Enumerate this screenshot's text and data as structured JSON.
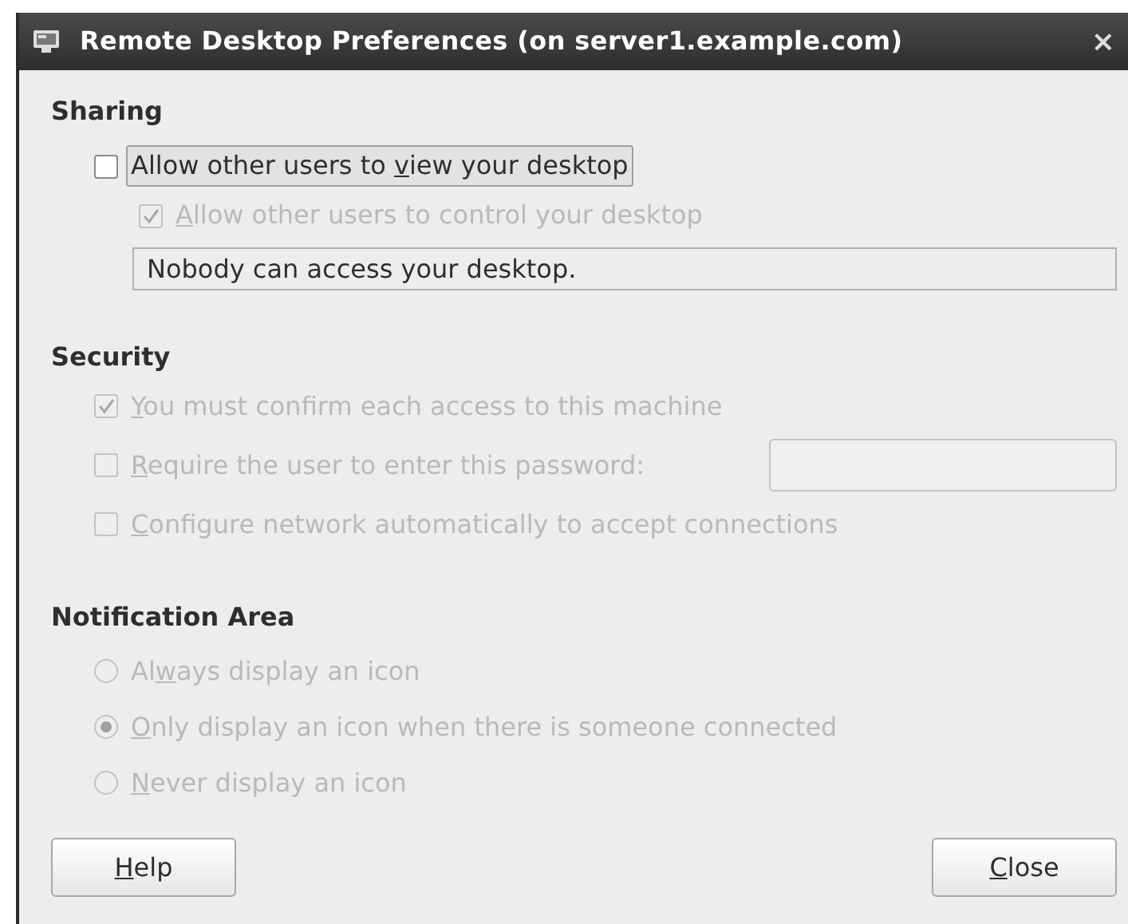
{
  "window": {
    "title": "Remote Desktop Preferences (on server1.example.com)",
    "close": "×"
  },
  "sharing": {
    "heading": "Sharing",
    "options": [
      {
        "kind": "checkbox",
        "before": "Allow other users to ",
        "mnemonic": "v",
        "after": "iew your desktop",
        "checked": false,
        "disabled": false,
        "focused": true,
        "children": [
          {
            "kind": "checkbox",
            "mnemonic": "A",
            "after": "llow other users to control your desktop",
            "checked": true,
            "disabled": true,
            "focused": false
          }
        ]
      }
    ],
    "status": "Nobody can access your desktop."
  },
  "security": {
    "heading": "Security",
    "options": [
      {
        "kind": "checkbox",
        "mnemonic": "Y",
        "after": "ou must confirm each access to this machine",
        "checked": true,
        "disabled": true,
        "focused": false
      },
      {
        "kind": "checkbox_with_field",
        "mnemonic": "R",
        "after": "equire the user to enter this password:",
        "checked": false,
        "disabled": true,
        "focused": false
      },
      {
        "kind": "checkbox",
        "mnemonic": "C",
        "after": "onfigure network automatically to accept connections",
        "checked": false,
        "disabled": true,
        "focused": false
      }
    ]
  },
  "notification_area": {
    "heading": "Notification Area",
    "options": [
      {
        "kind": "radio",
        "before": "Al",
        "mnemonic": "w",
        "after": "ays display an icon",
        "selected": false,
        "disabled": true
      },
      {
        "kind": "radio",
        "mnemonic": "O",
        "after": "nly display an icon when there is someone connected",
        "selected": true,
        "disabled": true
      },
      {
        "kind": "radio",
        "mnemonic": "N",
        "after": "ever display an icon",
        "selected": false,
        "disabled": true
      }
    ]
  },
  "buttons": [
    {
      "mnemonic": "H",
      "after": "elp"
    },
    {
      "mnemonic": "C",
      "after": "lose"
    }
  ]
}
